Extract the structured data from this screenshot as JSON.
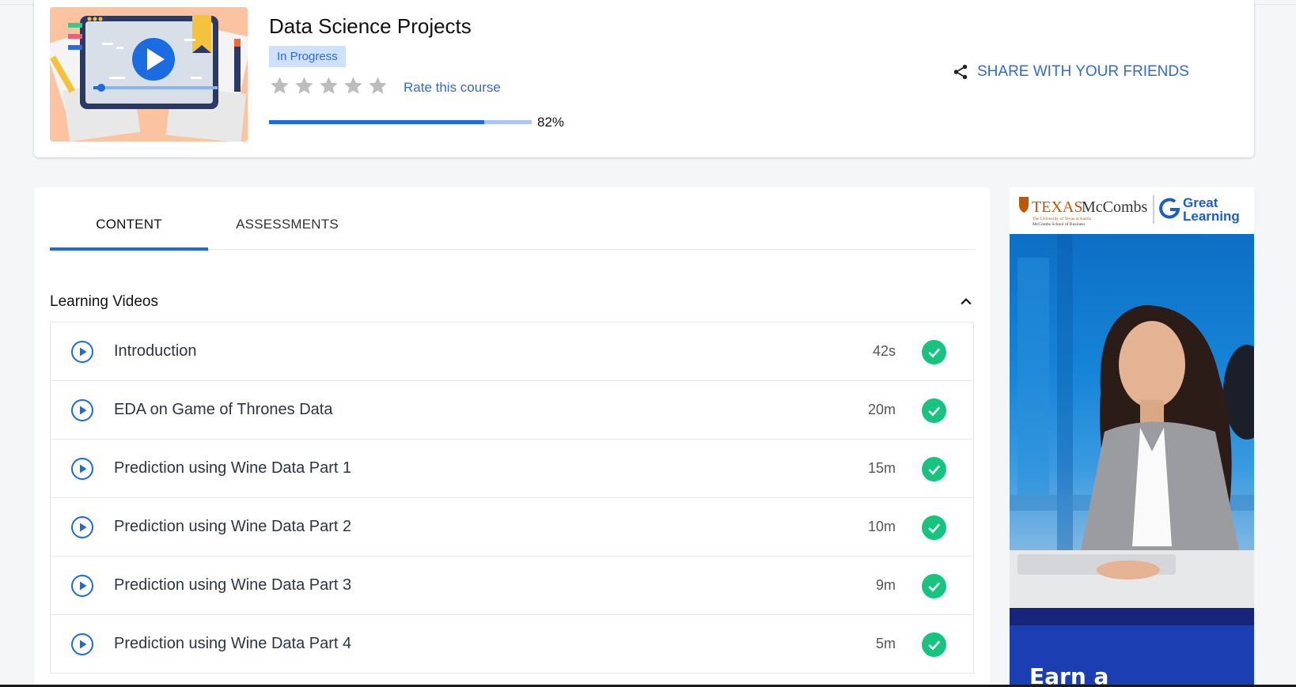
{
  "course": {
    "title": "Data Science Projects",
    "status": "In Progress",
    "rating_stars": 5,
    "rating_value": 0,
    "rate_label": "Rate this course",
    "progress_percent": 82,
    "progress_label": "82%",
    "share_label": "SHARE WITH YOUR FRIENDS"
  },
  "tabs": [
    {
      "label": "CONTENT",
      "active": true
    },
    {
      "label": "ASSESSMENTS",
      "active": false
    }
  ],
  "section": {
    "title": "Learning Videos",
    "expanded": true
  },
  "videos": [
    {
      "title": "Introduction",
      "duration": "42s",
      "completed": true
    },
    {
      "title": "EDA on Game of Thrones Data",
      "duration": "20m",
      "completed": true
    },
    {
      "title": "Prediction using Wine Data Part 1",
      "duration": "15m",
      "completed": true
    },
    {
      "title": "Prediction using Wine Data Part 2",
      "duration": "10m",
      "completed": true
    },
    {
      "title": "Prediction using Wine Data Part 3",
      "duration": "9m",
      "completed": true
    },
    {
      "title": "Prediction using Wine Data Part 4",
      "duration": "5m",
      "completed": true
    }
  ],
  "ad": {
    "logo_left": "TEXAS McCombs",
    "logo_left_sub": "The University of Texas at Austin",
    "logo_left_sub2": "McCombs School of Business",
    "logo_right": "Great Learning",
    "cta": "Earn a"
  },
  "colors": {
    "accent": "#1a6ce0",
    "link": "#2f6bd8",
    "success": "#16c47f",
    "badge_bg": "#cfe0fb"
  }
}
